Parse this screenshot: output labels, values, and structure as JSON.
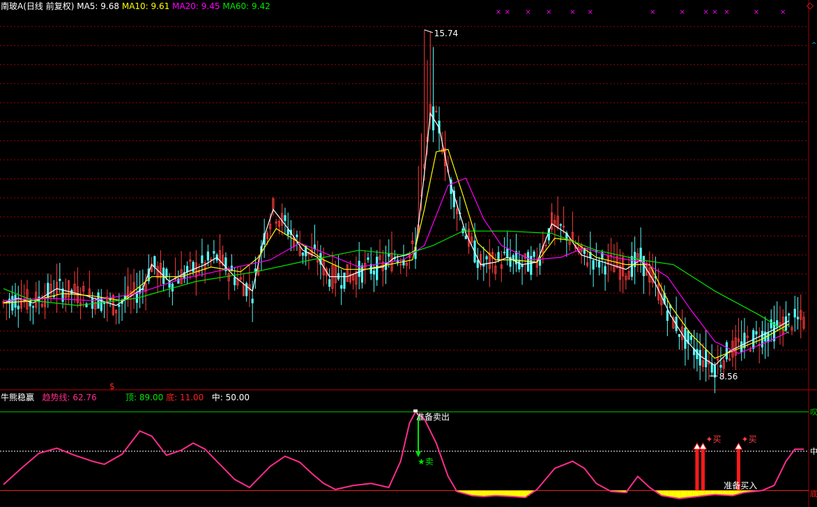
{
  "header": {
    "stock_name": "南玻A(日线 前复权)",
    "ma5_label": "MA5:",
    "ma5_value": "9.68",
    "ma10_label": "MA10:",
    "ma10_value": "9.61",
    "ma20_label": "MA20:",
    "ma20_value": "9.45",
    "ma60_label": "MA60:",
    "ma60_value": "9.42",
    "corner_marker": "◇",
    "corner_marker_2": "^"
  },
  "indicator_header": {
    "name": "牛熊稳赢",
    "trend_label": "趋势线:",
    "trend_value": "62.76",
    "top_label": "顶:",
    "top_value": "89.00",
    "bottom_label": "底:",
    "bottom_value": "11.00",
    "mid_label": "中:",
    "mid_value": "50.00",
    "dollar_marker": "$"
  },
  "colors": {
    "candle_up": "#ff3c3c",
    "candle_down": "#54fcfc",
    "ma5": "#ffffff",
    "ma10": "#ffff00",
    "ma20": "#ff00ff",
    "ma60": "#00e600",
    "trend": "#ff2c8c",
    "top_line": "#00c000",
    "bottom_line": "#ff2020",
    "buy_bar": "#ff1a1a",
    "bottom_fill": "#ffff00",
    "grid": "#a00000"
  },
  "chart_data": [
    {
      "type": "candlestick",
      "title": "南玻A(日线 前复权)",
      "annotations": {
        "high_label": "15.74",
        "low_label": "8.56"
      },
      "ylim": [
        8.3,
        16.1
      ],
      "x_index_range": [
        0,
        270
      ],
      "top_markers": {
        "symbol": "×",
        "at_index": [
          167,
          170,
          177,
          184,
          192,
          198,
          219,
          229,
          237,
          240,
          244,
          254,
          263
        ]
      },
      "series": [
        {
          "name": "MA5",
          "points": [
            [
              0,
              10.05
            ],
            [
              5,
              10.15
            ],
            [
              10,
              10.05
            ],
            [
              18,
              10.35
            ],
            [
              28,
              10.2
            ],
            [
              38,
              10.0
            ],
            [
              47,
              10.35
            ],
            [
              50,
              10.85
            ],
            [
              56,
              10.5
            ],
            [
              62,
              10.7
            ],
            [
              68,
              10.85
            ],
            [
              72,
              11.0
            ],
            [
              78,
              10.6
            ],
            [
              84,
              10.3
            ],
            [
              88,
              11.45
            ],
            [
              91,
              12.0
            ],
            [
              96,
              11.6
            ],
            [
              101,
              11.15
            ],
            [
              106,
              11.0
            ],
            [
              110,
              10.6
            ],
            [
              116,
              10.6
            ],
            [
              122,
              10.75
            ],
            [
              128,
              10.8
            ],
            [
              132,
              11.0
            ],
            [
              136,
              11.05
            ],
            [
              139,
              11.15
            ],
            [
              142,
              12.75
            ],
            [
              144,
              14.0
            ],
            [
              147,
              13.7
            ],
            [
              151,
              12.5
            ],
            [
              156,
              11.5
            ],
            [
              161,
              10.85
            ],
            [
              166,
              10.9
            ],
            [
              170,
              11.0
            ],
            [
              175,
              10.85
            ],
            [
              180,
              10.9
            ],
            [
              185,
              11.7
            ],
            [
              190,
              11.5
            ],
            [
              195,
              11.05
            ],
            [
              200,
              10.95
            ],
            [
              205,
              10.85
            ],
            [
              210,
              10.75
            ],
            [
              215,
              10.95
            ],
            [
              220,
              10.45
            ],
            [
              225,
              9.8
            ],
            [
              230,
              9.3
            ],
            [
              235,
              8.95
            ],
            [
              240,
              8.75
            ],
            [
              245,
              9.05
            ],
            [
              250,
              9.2
            ],
            [
              255,
              9.35
            ],
            [
              260,
              9.5
            ],
            [
              265,
              9.68
            ]
          ]
        },
        {
          "name": "MA10",
          "points": [
            [
              0,
              10.05
            ],
            [
              10,
              10.1
            ],
            [
              20,
              10.25
            ],
            [
              30,
              10.2
            ],
            [
              40,
              10.1
            ],
            [
              50,
              10.6
            ],
            [
              60,
              10.6
            ],
            [
              70,
              10.8
            ],
            [
              80,
              10.7
            ],
            [
              86,
              11.0
            ],
            [
              92,
              11.6
            ],
            [
              100,
              11.3
            ],
            [
              108,
              10.95
            ],
            [
              115,
              10.75
            ],
            [
              122,
              10.75
            ],
            [
              130,
              10.85
            ],
            [
              138,
              10.95
            ],
            [
              142,
              12.0
            ],
            [
              146,
              13.2
            ],
            [
              150,
              13.25
            ],
            [
              155,
              12.3
            ],
            [
              160,
              11.3
            ],
            [
              166,
              10.95
            ],
            [
              172,
              10.95
            ],
            [
              180,
              10.9
            ],
            [
              186,
              11.4
            ],
            [
              192,
              11.35
            ],
            [
              200,
              11.0
            ],
            [
              210,
              10.85
            ],
            [
              218,
              10.85
            ],
            [
              225,
              10.0
            ],
            [
              232,
              9.4
            ],
            [
              240,
              8.9
            ],
            [
              248,
              9.1
            ],
            [
              256,
              9.3
            ],
            [
              265,
              9.61
            ]
          ]
        },
        {
          "name": "MA20",
          "points": [
            [
              0,
              10.1
            ],
            [
              15,
              10.15
            ],
            [
              30,
              10.1
            ],
            [
              45,
              10.25
            ],
            [
              60,
              10.55
            ],
            [
              75,
              10.75
            ],
            [
              90,
              10.95
            ],
            [
              100,
              11.3
            ],
            [
              110,
              11.05
            ],
            [
              120,
              10.8
            ],
            [
              135,
              10.95
            ],
            [
              142,
              11.25
            ],
            [
              150,
              12.5
            ],
            [
              156,
              12.65
            ],
            [
              162,
              11.8
            ],
            [
              168,
              11.25
            ],
            [
              178,
              10.95
            ],
            [
              188,
              11.0
            ],
            [
              196,
              11.2
            ],
            [
              206,
              11.0
            ],
            [
              216,
              10.9
            ],
            [
              224,
              10.6
            ],
            [
              232,
              9.9
            ],
            [
              240,
              9.25
            ],
            [
              248,
              9.0
            ],
            [
              258,
              9.25
            ],
            [
              265,
              9.45
            ]
          ]
        },
        {
          "name": "MA60",
          "points": [
            [
              0,
              10.35
            ],
            [
              10,
              10.1
            ],
            [
              25,
              10.0
            ],
            [
              45,
              10.15
            ],
            [
              65,
              10.5
            ],
            [
              85,
              10.7
            ],
            [
              100,
              10.9
            ],
            [
              120,
              11.15
            ],
            [
              135,
              11.05
            ],
            [
              145,
              11.25
            ],
            [
              155,
              11.55
            ],
            [
              170,
              11.55
            ],
            [
              185,
              11.5
            ],
            [
              200,
              11.15
            ],
            [
              215,
              10.95
            ],
            [
              226,
              10.85
            ],
            [
              240,
              10.3
            ],
            [
              255,
              9.8
            ],
            [
              265,
              9.42
            ]
          ]
        }
      ]
    },
    {
      "type": "line",
      "title": "牛熊稳赢",
      "ylim": [
        5,
        95
      ],
      "reference_lines": {
        "top": 89,
        "mid": 50,
        "bottom": 11
      },
      "annotations": {
        "sell_prepare": "准备卖出",
        "sell": "★卖",
        "buy": "✦买",
        "buy_prepare": "准备买入",
        "top_tag": "叹",
        "mid_tag": "中",
        "bottom_tag": "底"
      },
      "signals": {
        "sell_index": 139,
        "buy_index": [
          234,
          236,
          248
        ]
      },
      "series": [
        {
          "name": "趋势线",
          "points": [
            [
              0,
              17
            ],
            [
              6,
              33
            ],
            [
              12,
              48
            ],
            [
              18,
              53
            ],
            [
              24,
              46
            ],
            [
              30,
              40
            ],
            [
              34,
              37
            ],
            [
              40,
              47
            ],
            [
              46,
              70
            ],
            [
              50,
              65
            ],
            [
              55,
              46
            ],
            [
              60,
              51
            ],
            [
              64,
              58
            ],
            [
              68,
              52
            ],
            [
              72,
              40
            ],
            [
              78,
              22
            ],
            [
              83,
              14
            ],
            [
              90,
              35
            ],
            [
              95,
              45
            ],
            [
              100,
              39
            ],
            [
              104,
              28
            ],
            [
              108,
              18
            ],
            [
              112,
              12
            ],
            [
              118,
              16
            ],
            [
              124,
              18
            ],
            [
              130,
              14
            ],
            [
              134,
              40
            ],
            [
              137,
              78
            ],
            [
              139,
              89
            ],
            [
              142,
              82
            ],
            [
              146,
              58
            ],
            [
              150,
              25
            ],
            [
              153,
              10
            ],
            [
              158,
              6
            ],
            [
              162,
              5
            ],
            [
              166,
              6
            ],
            [
              172,
              5
            ],
            [
              176,
              4
            ],
            [
              180,
              12
            ],
            [
              186,
              33
            ],
            [
              192,
              40
            ],
            [
              196,
              33
            ],
            [
              200,
              18
            ],
            [
              205,
              10
            ],
            [
              210,
              9
            ],
            [
              214,
              25
            ],
            [
              218,
              14
            ],
            [
              222,
              6
            ],
            [
              228,
              3
            ],
            [
              234,
              5
            ],
            [
              240,
              7
            ],
            [
              246,
              6
            ],
            [
              250,
              9
            ],
            [
              256,
              11
            ],
            [
              260,
              16
            ],
            [
              264,
              40
            ],
            [
              267,
              52
            ],
            [
              270,
              52
            ]
          ]
        }
      ]
    }
  ]
}
